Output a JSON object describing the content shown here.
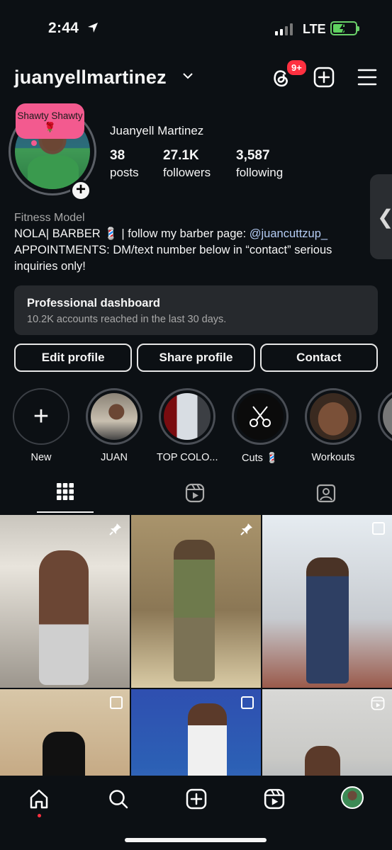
{
  "status_bar": {
    "time": "2:44",
    "network": "LTE"
  },
  "header": {
    "username": "juanyellmartinez",
    "notification_badge": "9+"
  },
  "profile": {
    "note": "Shawty Shawty 🌹",
    "full_name": "Juanyell Martinez",
    "stats": [
      {
        "num": "38",
        "label": "posts"
      },
      {
        "num": "27.1K",
        "label": "followers"
      },
      {
        "num": "3,587",
        "label": "following"
      }
    ],
    "category": "Fitness Model",
    "bio_line1_prefix": "NOLA| BARBER 💈 | follow my barber page: ",
    "bio_mention": "@juancuttzup_",
    "bio_line2": "APPOINTMENTS: DM/text number below in “contact” serious inquiries only!"
  },
  "dashboard": {
    "title": "Professional dashboard",
    "subtitle": "10.2K accounts reached in the last 30 days."
  },
  "buttons": {
    "edit": "Edit profile",
    "share": "Share profile",
    "contact": "Contact"
  },
  "highlights": [
    {
      "label": "New"
    },
    {
      "label": "JUAN"
    },
    {
      "label": "TOP COLO..."
    },
    {
      "label": "Cuts 💈"
    },
    {
      "label": "Workouts"
    }
  ],
  "colors": {
    "background": "#0c1014",
    "badge": "#ff3040",
    "mention": "#b5cdf5",
    "note": "#f35a8f"
  },
  "icons": [
    "location-arrow-icon",
    "threads-icon",
    "plus-square-icon",
    "hamburger-menu-icon",
    "grid-icon",
    "reels-icon",
    "tagged-icon",
    "pin-icon",
    "home-icon",
    "search-icon",
    "create-icon",
    "reels-nav-icon"
  ]
}
